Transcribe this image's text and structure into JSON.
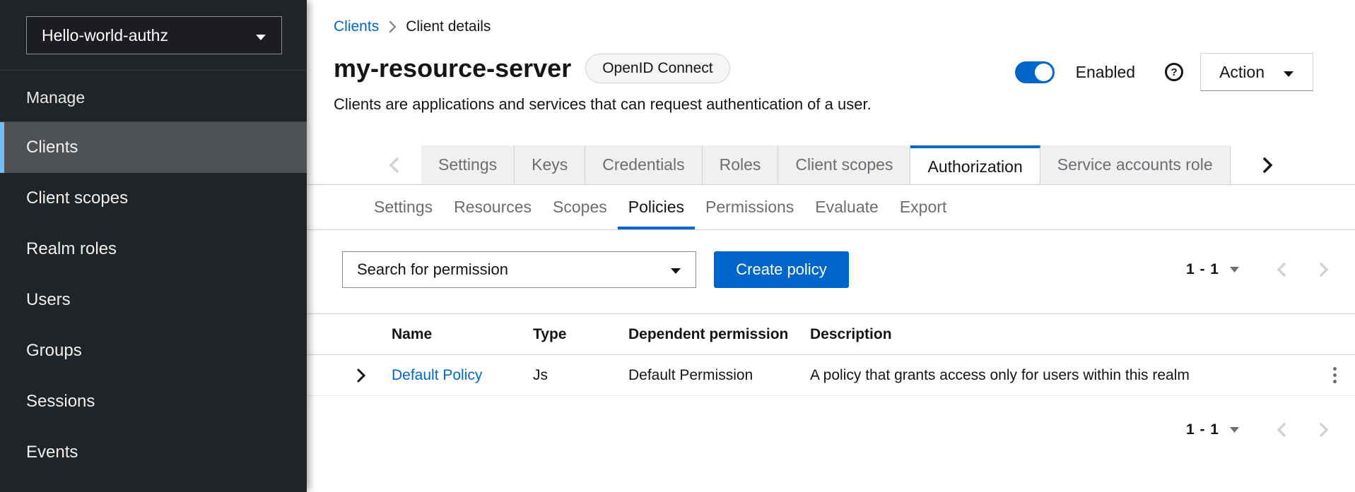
{
  "sidebar": {
    "realm_selector": {
      "value": "Hello-world-authz"
    },
    "section_label": "Manage",
    "items": [
      {
        "label": "Clients",
        "active": true
      },
      {
        "label": "Client scopes",
        "active": false
      },
      {
        "label": "Realm roles",
        "active": false
      },
      {
        "label": "Users",
        "active": false
      },
      {
        "label": "Groups",
        "active": false
      },
      {
        "label": "Sessions",
        "active": false
      },
      {
        "label": "Events",
        "active": false
      }
    ]
  },
  "breadcrumb": {
    "items": [
      "Clients",
      "Client details"
    ]
  },
  "header": {
    "title": "my-resource-server",
    "badge": "OpenID Connect",
    "description": "Clients are applications and services that can request authentication of a user.",
    "enabled_label": "Enabled",
    "action_label": "Action"
  },
  "tabs": {
    "items": [
      "Settings",
      "Keys",
      "Credentials",
      "Roles",
      "Client scopes",
      "Authorization",
      "Service accounts role"
    ],
    "active": "Authorization"
  },
  "subtabs": {
    "items": [
      "Settings",
      "Resources",
      "Scopes",
      "Policies",
      "Permissions",
      "Evaluate",
      "Export"
    ],
    "active": "Policies"
  },
  "toolbar": {
    "search_value": "Search for permission",
    "create_button": "Create policy",
    "pagination": "1 - 1"
  },
  "table": {
    "headers": [
      "Name",
      "Type",
      "Dependent permission",
      "Description"
    ],
    "rows": [
      {
        "name": "Default Policy",
        "type": "Js",
        "dependent": "Default Permission",
        "description": "A policy that grants access only for users within this realm"
      }
    ]
  },
  "footer": {
    "pagination": "1 - 1"
  },
  "colors": {
    "primary": "#0066cc",
    "sidebar_bg": "#212427",
    "active_nav_bg": "#4f5255",
    "nav_accent": "#73bcf7",
    "tab_bg": "#f0f0f0"
  }
}
